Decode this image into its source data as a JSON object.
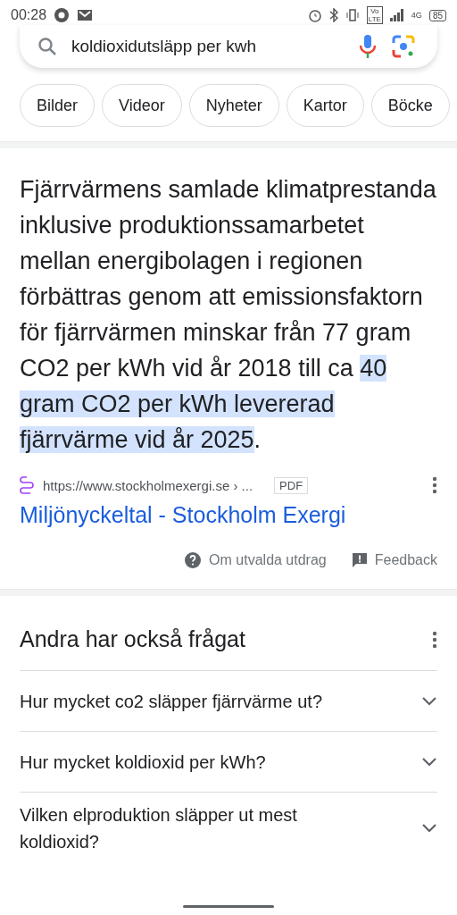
{
  "status_bar": {
    "time": "00:28",
    "volte": "Vo LTE",
    "network": "4G",
    "battery": "85"
  },
  "search": {
    "value": "koldioxidutsläpp per kwh"
  },
  "chips": [
    {
      "label": "Bilder"
    },
    {
      "label": "Videor"
    },
    {
      "label": "Nyheter"
    },
    {
      "label": "Kartor"
    },
    {
      "label": "Böcke"
    }
  ],
  "snippet": {
    "segments": [
      {
        "text": "Fjärrvärmens samlade klimatprestanda inklusive produktionssamarbetet mellan energibolagen i regionen förbättras genom att emissionsfaktorn för fjärrvärmen minskar från 77 gram CO2 per kWh vid år 2018 till ca ",
        "highlighted": false
      },
      {
        "text": "40 gram CO2 per kWh levererad fjärrvärme vid år 2025",
        "highlighted": true
      },
      {
        "text": ".",
        "highlighted": false
      }
    ],
    "source_url": "https://www.stockholmexergi.se › ...",
    "file_type": "PDF",
    "title": "Miljönyckeltal - Stockholm Exergi",
    "about_link": "Om utvalda utdrag",
    "feedback_link": "Feedback"
  },
  "related_questions": {
    "title": "Andra har också frågat",
    "items": [
      {
        "question": "Hur mycket co2 släpper fjärrvärme ut?",
        "expanded": false
      },
      {
        "question": "Hur mycket koldioxid per kWh?",
        "expanded": false
      },
      {
        "question": "Vilken elproduktion släpper ut mest koldioxid?",
        "expanded": false
      }
    ]
  }
}
